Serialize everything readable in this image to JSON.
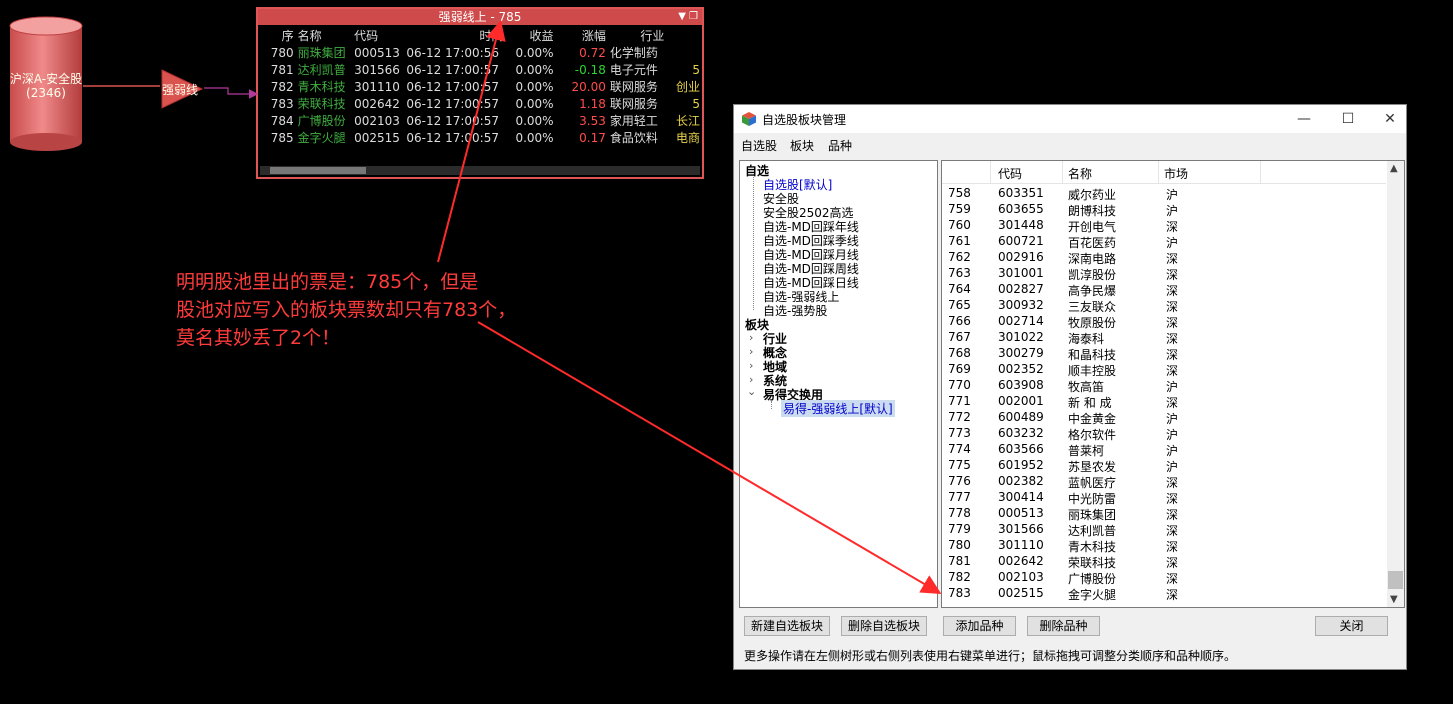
{
  "flow": {
    "source_label": "沪深A-安全股",
    "source_count": "(2346)",
    "filter_label": "强弱线"
  },
  "pool": {
    "title": "强弱线上 - 785",
    "columns": [
      "序",
      "名称",
      "代码",
      "时间",
      "收益",
      "涨幅",
      "行业"
    ],
    "rows": [
      {
        "seq": "780",
        "name": "丽珠集团",
        "code": "000513",
        "time": "06-12 17:00:56",
        "ret": "0.00%",
        "chg": "0.72",
        "dir": "up",
        "ind": "化学制药",
        "ext": ""
      },
      {
        "seq": "781",
        "name": "达利凯普",
        "code": "301566",
        "time": "06-12 17:00:57",
        "ret": "0.00%",
        "chg": "-0.18",
        "dir": "dn",
        "ind": "电子元件",
        "ext": "5"
      },
      {
        "seq": "782",
        "name": "青木科技",
        "code": "301110",
        "time": "06-12 17:00:57",
        "ret": "0.00%",
        "chg": "20.00",
        "dir": "up",
        "ind": "联网服务",
        "ext": "创业"
      },
      {
        "seq": "783",
        "name": "荣联科技",
        "code": "002642",
        "time": "06-12 17:00:57",
        "ret": "0.00%",
        "chg": "1.18",
        "dir": "up",
        "ind": "联网服务",
        "ext": "5"
      },
      {
        "seq": "784",
        "name": "广博股份",
        "code": "002103",
        "time": "06-12 17:00:57",
        "ret": "0.00%",
        "chg": "3.53",
        "dir": "up",
        "ind": "家用轻工",
        "ext": "长江"
      },
      {
        "seq": "785",
        "name": "金字火腿",
        "code": "002515",
        "time": "06-12 17:00:57",
        "ret": "0.00%",
        "chg": "0.17",
        "dir": "up",
        "ind": "食品饮料",
        "ext": "电商"
      }
    ]
  },
  "annotation": {
    "line1": "明明股池里出的票是：785个，但是",
    "line2": "股池对应写入的板块票数却只有783个，",
    "line3": "莫名其妙丢了2个！"
  },
  "dialog": {
    "title": "自选股板块管理",
    "menu": [
      "自选股",
      "板块",
      "品种"
    ],
    "tree": {
      "root1": "自选",
      "items1": [
        "自选股[默认]",
        "安全股",
        "安全股2502高选",
        "自选-MD回踩年线",
        "自选-MD回踩季线",
        "自选-MD回踩月线",
        "自选-MD回踩周线",
        "自选-MD回踩日线",
        "自选-强弱线上",
        "自选-强势股"
      ],
      "root2": "板块",
      "groups": [
        "行业",
        "概念",
        "地域",
        "系统",
        "易得交换用"
      ],
      "leaf": "易得-强弱线上[默认]"
    },
    "list_headers": [
      "代码",
      "名称",
      "市场"
    ],
    "rows": [
      [
        "758",
        "603351",
        "威尔药业",
        "沪"
      ],
      [
        "759",
        "603655",
        "朗博科技",
        "沪"
      ],
      [
        "760",
        "301448",
        "开创电气",
        "深"
      ],
      [
        "761",
        "600721",
        "百花医药",
        "沪"
      ],
      [
        "762",
        "002916",
        "深南电路",
        "深"
      ],
      [
        "763",
        "301001",
        "凯淳股份",
        "深"
      ],
      [
        "764",
        "002827",
        "高争民爆",
        "深"
      ],
      [
        "765",
        "300932",
        "三友联众",
        "深"
      ],
      [
        "766",
        "002714",
        "牧原股份",
        "深"
      ],
      [
        "767",
        "301022",
        "海泰科",
        "深"
      ],
      [
        "768",
        "300279",
        "和晶科技",
        "深"
      ],
      [
        "769",
        "002352",
        "顺丰控股",
        "深"
      ],
      [
        "770",
        "603908",
        "牧高笛",
        "沪"
      ],
      [
        "771",
        "002001",
        "新 和 成",
        "深"
      ],
      [
        "772",
        "600489",
        "中金黄金",
        "沪"
      ],
      [
        "773",
        "603232",
        "格尔软件",
        "沪"
      ],
      [
        "774",
        "603566",
        "普莱柯",
        "沪"
      ],
      [
        "775",
        "601952",
        "苏垦农发",
        "沪"
      ],
      [
        "776",
        "002382",
        "蓝帆医疗",
        "深"
      ],
      [
        "777",
        "300414",
        "中光防雷",
        "深"
      ],
      [
        "778",
        "000513",
        "丽珠集团",
        "深"
      ],
      [
        "779",
        "301566",
        "达利凯普",
        "深"
      ],
      [
        "780",
        "301110",
        "青木科技",
        "深"
      ],
      [
        "781",
        "002642",
        "荣联科技",
        "深"
      ],
      [
        "782",
        "002103",
        "广博股份",
        "深"
      ],
      [
        "783",
        "002515",
        "金字火腿",
        "深"
      ]
    ],
    "buttons": {
      "new_block": "新建自选板块",
      "delete_block": "删除自选板块",
      "add_stock": "添加品种",
      "delete_stock": "删除品种",
      "close": "关闭"
    },
    "footer": "更多操作请在左侧树形或右侧列表使用右键菜单进行；鼠标拖拽可调整分类顺序和品种顺序。"
  },
  "colors": {
    "annotation": "#ff3b3b",
    "pool_border": "#e05555",
    "flow_node": "#d9534f",
    "up": "#ff4d4d",
    "down": "#2fd32f",
    "stock_name": "#3fae3f"
  }
}
